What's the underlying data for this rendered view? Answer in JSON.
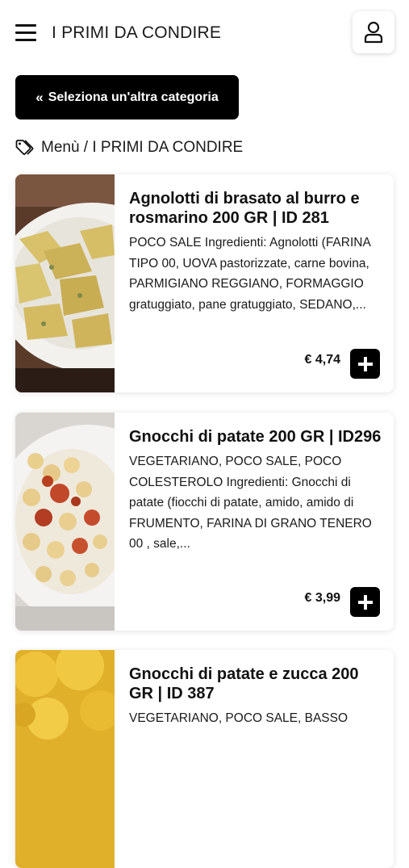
{
  "header": {
    "title": "I PRIMI DA CONDIRE"
  },
  "category_button": {
    "label": "Seleziona un'altra categoria"
  },
  "breadcrumb": {
    "text": "Menù / I PRIMI DA CONDIRE"
  },
  "products": [
    {
      "name": "Agnolotti di brasato al burro e rosmarino 200 GR | ID 281",
      "description": "POCO SALE Ingredienti: Agnolotti (FARINA TIPO 00, UOVA pastorizzate, carne bovina, PARMIGIANO REGGIANO, FORMAGGIO gratuggiato, pane gratuggiato, SEDANO,...",
      "price": "€ 4,74"
    },
    {
      "name": "Gnocchi di patate 200 GR | ID296",
      "description": "VEGETARIANO, POCO SALE, POCO COLESTEROLO Ingredienti: Gnocchi di patate (fiocchi di patate, amido, amido di FRUMENTO, FARINA DI GRANO TENERO 00 , sale,...",
      "price": "€ 3,99"
    },
    {
      "name": "Gnocchi di patate e zucca 200 GR | ID 387",
      "description": "VEGETARIANO, POCO SALE, BASSO",
      "price": ""
    }
  ],
  "icons": {
    "menu": "hamburger-menu-icon",
    "user": "user-icon",
    "back": "double-chevron-left-icon",
    "tag": "tags-icon",
    "add": "plus-icon"
  },
  "colors": {
    "accent": "#000000",
    "background": "#ffffff"
  }
}
